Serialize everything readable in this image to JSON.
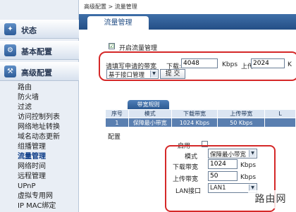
{
  "breadcrumb": "高级配置 > 流量管理",
  "page_title": "流量管理",
  "sidebar": {
    "sections": [
      {
        "label": "状态",
        "icon": "status-icon"
      },
      {
        "label": "基本配置",
        "icon": "gear-icon"
      },
      {
        "label": "高级配置",
        "icon": "tools-icon"
      }
    ],
    "items": [
      "路由",
      "防火墙",
      "过滤",
      "访问控制列表",
      "网络地址转换",
      "域名动态更新",
      "组播管理",
      "流量管理",
      "网络时间",
      "远程管理",
      "UPnP",
      "虚拟专用网",
      "IP MAC绑定"
    ],
    "active_item": "流量管理"
  },
  "enable": {
    "label": "开启流量管理",
    "checked_mark": "☑"
  },
  "bandwidth": {
    "prompt": "请填写申请的带宽",
    "download_label": "下载:",
    "download_value": "4048",
    "upload_label": "上传:",
    "upload_value": "2024",
    "unit": "Kbps",
    "unit_cut": "K",
    "mode_value": "基于接口管理",
    "submit_label": "提 交"
  },
  "bw_list": {
    "tab_label": "带宽规则",
    "columns": [
      "序号",
      "模式",
      "下载带宽",
      "上传带宽",
      "L"
    ],
    "rows": [
      [
        "1",
        "保障最小带宽",
        "1024 Kbps",
        "50 Kbps",
        ""
      ]
    ]
  },
  "config": {
    "heading": "配置",
    "enable_label": "启用",
    "mode_label": "模式",
    "mode_value": "保障最小带宽",
    "download_label": "下载带宽",
    "download_value": "1024",
    "upload_label": "上传带宽",
    "upload_value": "50",
    "unit": "Kbps",
    "lan_label": "LAN接口",
    "lan_value": "LAN1"
  },
  "watermark": {
    "text": "路由网"
  }
}
